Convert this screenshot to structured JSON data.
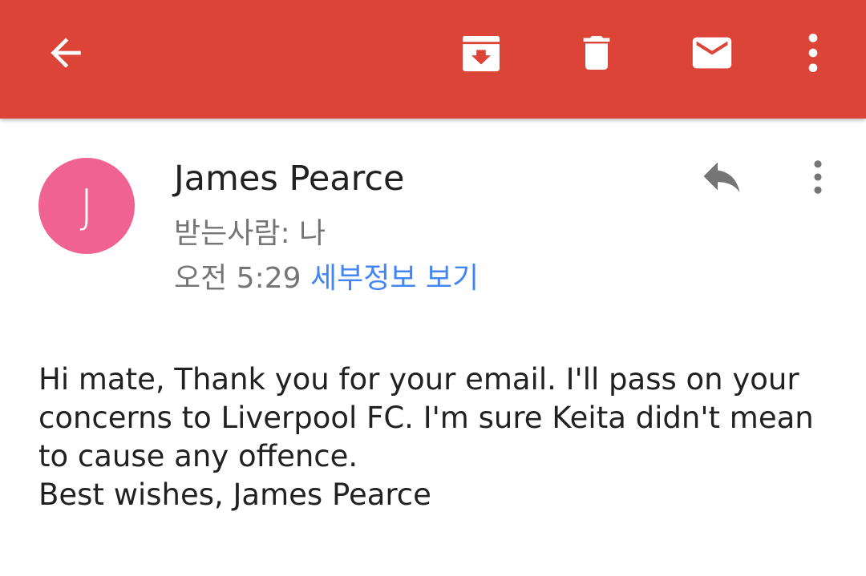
{
  "colors": {
    "app_bar": "#db4437",
    "avatar_bg": "#f06292",
    "link": "#4285f4",
    "secondary_text": "#757575",
    "primary_text": "#212121"
  },
  "toolbar": {
    "back_icon": "arrow-back-icon",
    "archive_icon": "archive-icon",
    "delete_icon": "trash-icon",
    "mark_unread_icon": "mail-icon",
    "overflow_icon": "more-vert-icon"
  },
  "message": {
    "avatar_initial": "J",
    "sender": "James Pearce",
    "recipient": "받는사람: 나",
    "time": "오전 5:29",
    "details_link": "세부정보 보기",
    "reply_icon": "reply-icon",
    "overflow_icon": "more-vert-icon",
    "body_lines": [
      "Hi mate, Thank you for your email. I'll pass on your concerns to Liverpool FC. I'm sure Keita didn't mean to cause any offence.",
      "Best wishes, James Pearce"
    ]
  }
}
